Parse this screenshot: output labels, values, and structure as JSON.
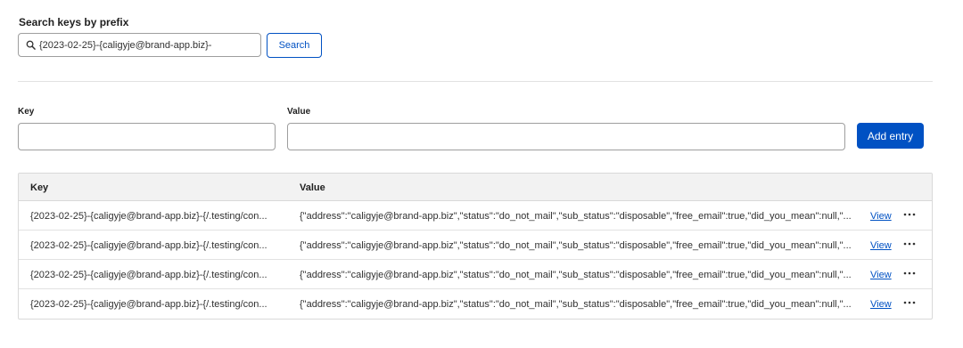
{
  "search": {
    "label": "Search keys by prefix",
    "value": "{2023-02-25}-{caligyje@brand-app.biz}-",
    "button_label": "Search"
  },
  "form": {
    "key_label": "Key",
    "value_label": "Value",
    "add_label": "Add entry"
  },
  "table": {
    "columns": [
      "Key",
      "Value"
    ],
    "rows": [
      {
        "key": "{2023-02-25}-{caligyje@brand-app.biz}-{/.testing/con...",
        "value": "{\"address\":\"caligyje@brand-app.biz\",\"status\":\"do_not_mail\",\"sub_status\":\"disposable\",\"free_email\":true,\"did_you_mean\":null,\"...",
        "action": "View"
      },
      {
        "key": "{2023-02-25}-{caligyje@brand-app.biz}-{/.testing/con...",
        "value": "{\"address\":\"caligyje@brand-app.biz\",\"status\":\"do_not_mail\",\"sub_status\":\"disposable\",\"free_email\":true,\"did_you_mean\":null,\"...",
        "action": "View"
      },
      {
        "key": "{2023-02-25}-{caligyje@brand-app.biz}-{/.testing/con...",
        "value": "{\"address\":\"caligyje@brand-app.biz\",\"status\":\"do_not_mail\",\"sub_status\":\"disposable\",\"free_email\":true,\"did_you_mean\":null,\"...",
        "action": "View"
      },
      {
        "key": "{2023-02-25}-{caligyje@brand-app.biz}-{/.testing/con...",
        "value": "{\"address\":\"caligyje@brand-app.biz\",\"status\":\"do_not_mail\",\"sub_status\":\"disposable\",\"free_email\":true,\"did_you_mean\":null,\"...",
        "action": "View"
      }
    ]
  },
  "icons": {
    "search": "search-icon",
    "more": "more-horizontal-icon"
  },
  "colors": {
    "accent": "#0051c3",
    "border": "#9e9e9e",
    "header_bg": "#f2f2f2"
  }
}
